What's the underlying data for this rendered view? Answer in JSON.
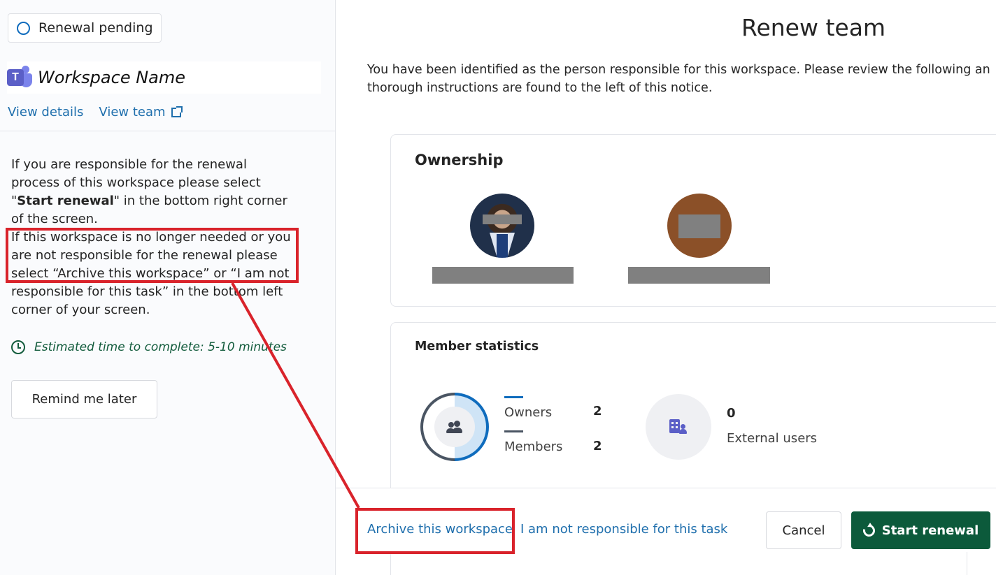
{
  "sidebar": {
    "status": "Renewal pending",
    "workspace_name": "Workspace Name",
    "teams_logo_letter": "T",
    "view_details": "View details",
    "view_team": "View team",
    "instructions": {
      "p1_before": "If you are responsible for the renewal process of this workspace please select \"",
      "p1_bold": "Start renewal",
      "p1_after": "\" in the bottom right corner of the screen.",
      "p2": "If this workspace is no longer needed or you are not responsible for the renewal please select “Archive this workspace” or “I am not responsible for this task” in the bottom left corner of your screen."
    },
    "estimated_time": "Estimated time to complete: 5-10 minutes",
    "remind_button": "Remind me later"
  },
  "main": {
    "title": "Renew team",
    "intro_line1": "You have been identified as the person responsible for this workspace. Please review the following an",
    "intro_line2": "thorough instructions are found to the left of this notice.",
    "ownership": {
      "heading": "Ownership"
    },
    "member_statistics": {
      "heading": "Member statistics",
      "owners_label": "Owners",
      "owners_count": "2",
      "members_label": "Members",
      "members_count": "2",
      "external_count": "0",
      "external_label": "External users"
    }
  },
  "footer": {
    "archive_link": "Archive this workspace",
    "not_responsible_link": "I am not responsible for this task",
    "cancel_button": "Cancel",
    "start_button": "Start renewal"
  },
  "colors": {
    "accent_link": "#1f6fad",
    "primary_button": "#0c5a3b",
    "annotation_red": "#d9232b",
    "owners_series": "#0f6cbd",
    "members_series": "#4a5563"
  }
}
